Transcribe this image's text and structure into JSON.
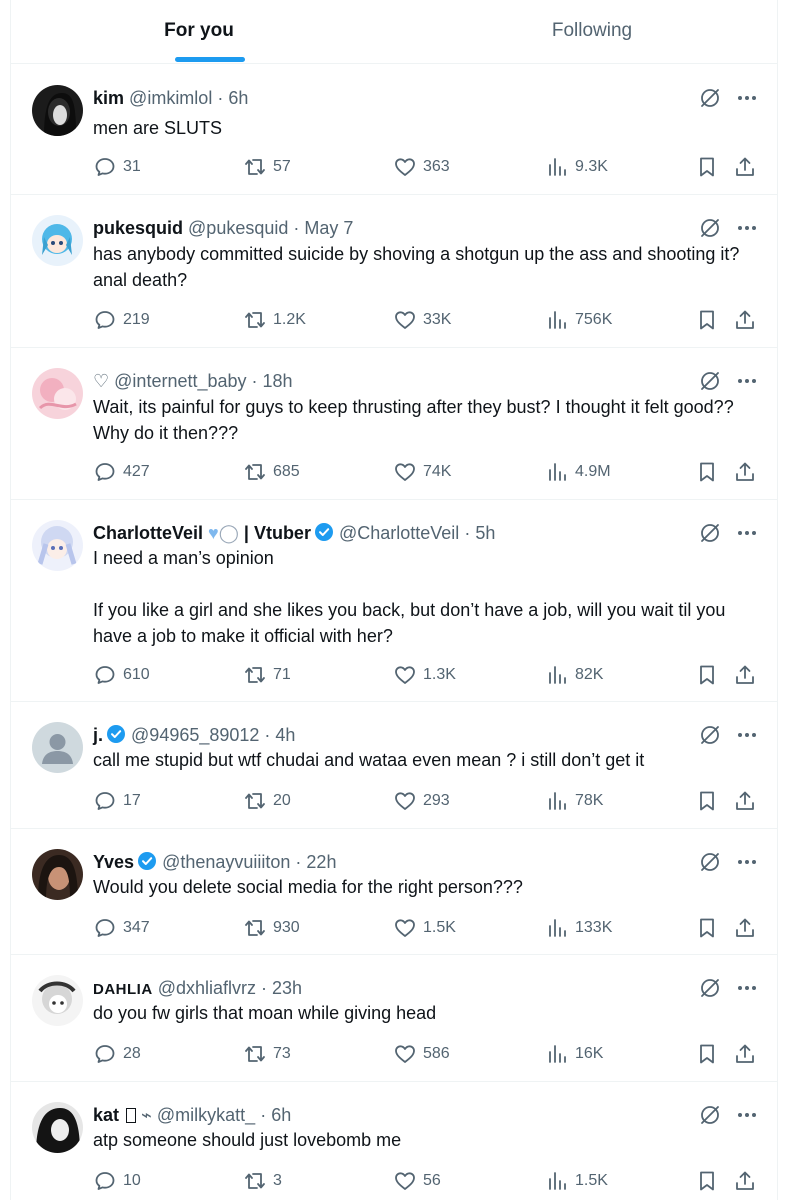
{
  "tabs": {
    "for_you": "For you",
    "following": "Following"
  },
  "posts": [
    {
      "name": "kim",
      "name_suffix": "",
      "handle": "@imkimlol",
      "time": "6h",
      "text": "men are SLUTS",
      "replies": "31",
      "retweets": "57",
      "likes": "363",
      "views": "9.3K",
      "verified": false
    },
    {
      "name": "pukesquid",
      "name_suffix": "",
      "handle": "@pukesquid",
      "time": "May 7",
      "text": "has anybody committed suicide by shoving a shotgun up the ass and shooting it? anal death?",
      "replies": "219",
      "retweets": "1.2K",
      "likes": "33K",
      "views": "756K",
      "verified": false
    },
    {
      "name": "♡",
      "name_suffix": "",
      "handle": "@internett_baby",
      "time": "18h",
      "text": "Wait, its painful for guys to keep thrusting after they bust? I thought it felt good?? Why do it then???",
      "replies": "427",
      "retweets": "685",
      "likes": "74K",
      "views": "4.9M",
      "verified": false
    },
    {
      "name": "CharlotteVeil",
      "name_suffix": "| Vtuber",
      "handle": "@CharlotteVeil",
      "time": "5h",
      "text": "I need a man’s opinion\n\nIf you like a girl and she likes you back, but don’t have a job, will you wait til you have a job to make it official with her?",
      "replies": "610",
      "retweets": "71",
      "likes": "1.3K",
      "views": "82K",
      "verified": true
    },
    {
      "name": "j.",
      "name_suffix": "",
      "handle": "@94965_89012",
      "time": "4h",
      "text": "call me stupid but wtf chudai and wataa even mean ? i still don’t get it",
      "replies": "17",
      "retweets": "20",
      "likes": "293",
      "views": "78K",
      "verified": true
    },
    {
      "name": "Yves",
      "name_suffix": "",
      "handle": "@thenayvuiiiton",
      "time": "22h",
      "text": "Would you delete social media for the right person???",
      "replies": "347",
      "retweets": "930",
      "likes": "1.5K",
      "views": "133K",
      "verified": true
    },
    {
      "name": "DAHLIA",
      "name_suffix": "",
      "handle": "@dxhliaflvrz",
      "time": "23h",
      "text": "do you fw girls that moan while giving head",
      "replies": "28",
      "retweets": "73",
      "likes": "586",
      "views": "16K",
      "verified": false
    },
    {
      "name": "kat",
      "name_suffix": "",
      "handle": "@milkykatt_",
      "time": "6h",
      "text": "atp someone should just lovebomb me",
      "replies": "10",
      "retweets": "3",
      "likes": "56",
      "views": "1.5K",
      "verified": false
    }
  ],
  "icons": {
    "reply": "reply-icon",
    "retweet": "retweet-icon",
    "like": "heart-icon",
    "views": "views-icon",
    "bookmark": "bookmark-icon",
    "share": "share-icon",
    "grok": "grok-icon",
    "more": "more-icon",
    "verified": "verified-badge-icon"
  },
  "colors": {
    "accent": "#1d9bf0",
    "text": "#0f1419",
    "muted": "#536471",
    "border": "#eff3f4"
  }
}
